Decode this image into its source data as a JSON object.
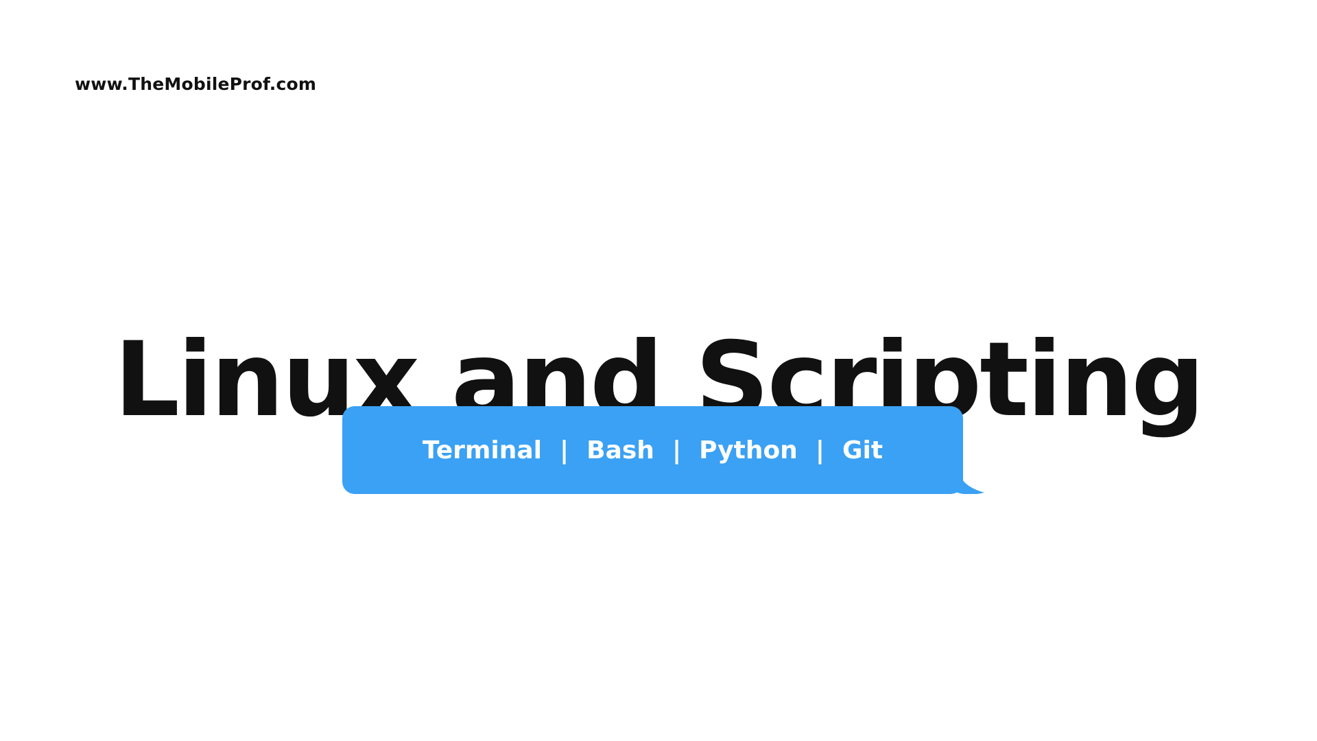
{
  "header": {
    "site_url": "www.TheMobileProf.com"
  },
  "main": {
    "title": "Linux and Scripting",
    "topics": [
      "Terminal",
      "Bash",
      "Python",
      "Git"
    ],
    "separator": "|"
  },
  "colors": {
    "background": "#ffffff",
    "text": "#111111",
    "bubble": "#3aa1f4",
    "bubble_text": "#ffffff"
  }
}
